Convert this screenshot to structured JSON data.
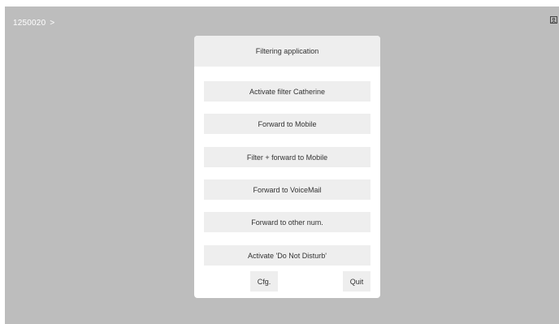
{
  "topbar": {
    "extension": "1250020",
    "chevron": ">"
  },
  "icons": {
    "corner": "phone-book-icon"
  },
  "dialog": {
    "title": "Filtering application",
    "options": [
      "Activate filter Catherine",
      "Forward to Mobile",
      "Filter + forward to Mobile",
      "Forward to VoiceMail",
      "Forward to other num.",
      "Activate 'Do Not Disturb'"
    ],
    "cfg_label": "Cfg.",
    "quit_label": "Quit"
  },
  "colors": {
    "screen_background": "#bdbdbd",
    "dialog_background": "#ffffff",
    "button_background": "#eeeeee",
    "text": "#333333"
  }
}
